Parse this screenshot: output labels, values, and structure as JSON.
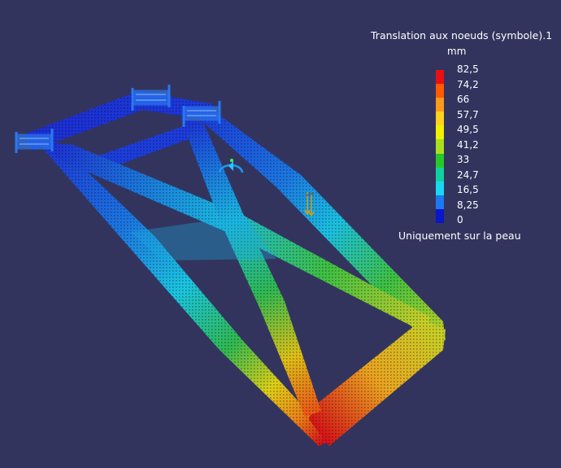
{
  "legend": {
    "title": "Translation aux noeuds (symbole).1",
    "unit": "mm",
    "values": [
      "82,5",
      "74,2",
      "66",
      "57,7",
      "49,5",
      "41,2",
      "33",
      "24,7",
      "16,5",
      "8,25",
      "0"
    ],
    "colors": [
      "#e81010",
      "#ff5a00",
      "#ff9a1a",
      "#ffd21e",
      "#f0f000",
      "#a8e020",
      "#28c828",
      "#10d0a0",
      "#18d8f0",
      "#1a78f0",
      "#0a14c8"
    ],
    "note": "Uniquement sur la peau"
  },
  "colors": {
    "background": "#33345e",
    "text": "#ffffff",
    "constraint": "#2a78f0"
  },
  "icons": {
    "clamp": "clamp-constraint-icon",
    "rotation": "rotation-axis-icon",
    "load": "load-arrow-icon"
  }
}
